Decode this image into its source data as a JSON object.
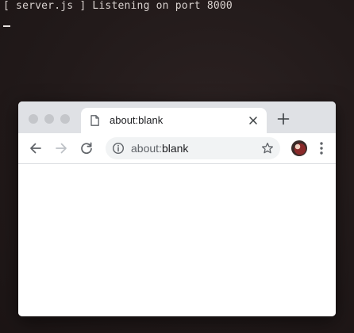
{
  "terminal": {
    "line": "[ server.js ] Listening on port 8000"
  },
  "browser": {
    "tab": {
      "title": "about:blank",
      "icon": "document-icon"
    },
    "toolbar": {
      "back_icon": "back-arrow-icon",
      "forward_icon": "forward-arrow-icon",
      "reload_icon": "reload-icon",
      "omnibox": {
        "scheme": "about:",
        "host": "blank",
        "icon": "info-icon"
      },
      "bookmark_icon": "star-icon",
      "menu_icon": "kebab-menu-icon"
    },
    "colors": {
      "tabstrip": "#dfe1e5",
      "omnibox": "#f1f3f4",
      "icon": "#5f6368",
      "disabled_icon": "#bdc1c6"
    }
  }
}
